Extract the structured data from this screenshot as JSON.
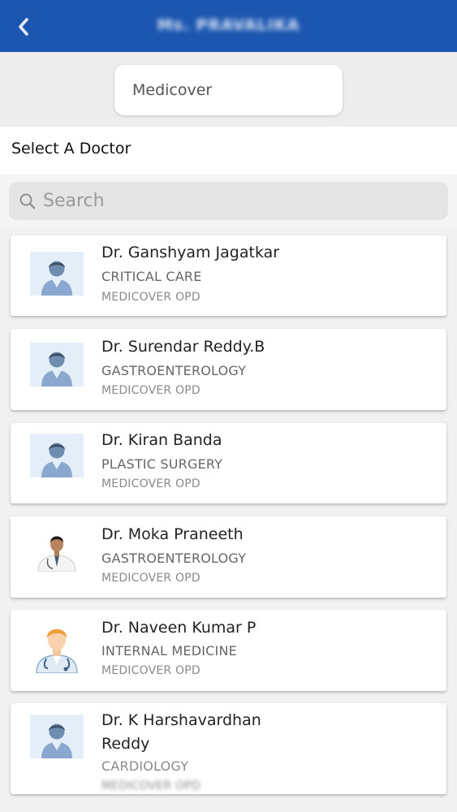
{
  "topbar": {
    "title": "Ms. PRAVALIKA",
    "back_icon": "chevron-left-icon",
    "color": "#1b56b0"
  },
  "hospital": {
    "name": "Medicover"
  },
  "section": {
    "label": "Select A Doctor"
  },
  "search": {
    "placeholder": "Search",
    "icon": "search-icon"
  },
  "doctors": [
    {
      "name": "Dr. Ganshyam Jagatkar",
      "specialty": "CRITICAL CARE",
      "location": "MEDICOVER OPD",
      "avatar": "doctor-placeholder-icon"
    },
    {
      "name": "Dr. Surendar Reddy.B",
      "specialty": "GASTROENTEROLOGY",
      "location": "MEDICOVER OPD",
      "avatar": "doctor-placeholder-icon"
    },
    {
      "name": "Dr. Kiran Banda",
      "specialty": "PLASTIC SURGERY",
      "location": "MEDICOVER OPD",
      "avatar": "doctor-placeholder-icon"
    },
    {
      "name": "Dr. Moka Praneeth",
      "specialty": "GASTROENTEROLOGY",
      "location": "MEDICOVER OPD",
      "avatar": "doctor-photo"
    },
    {
      "name": "Dr. Naveen Kumar P",
      "specialty": "INTERNAL MEDICINE",
      "location": "MEDICOVER OPD",
      "avatar": "doctor-cartoon-icon"
    },
    {
      "name": "Dr. K Harshavardhan Reddy",
      "specialty": "CARDIOLOGY",
      "location": "MEDICOVER OPD",
      "avatar": "doctor-placeholder-icon"
    }
  ]
}
